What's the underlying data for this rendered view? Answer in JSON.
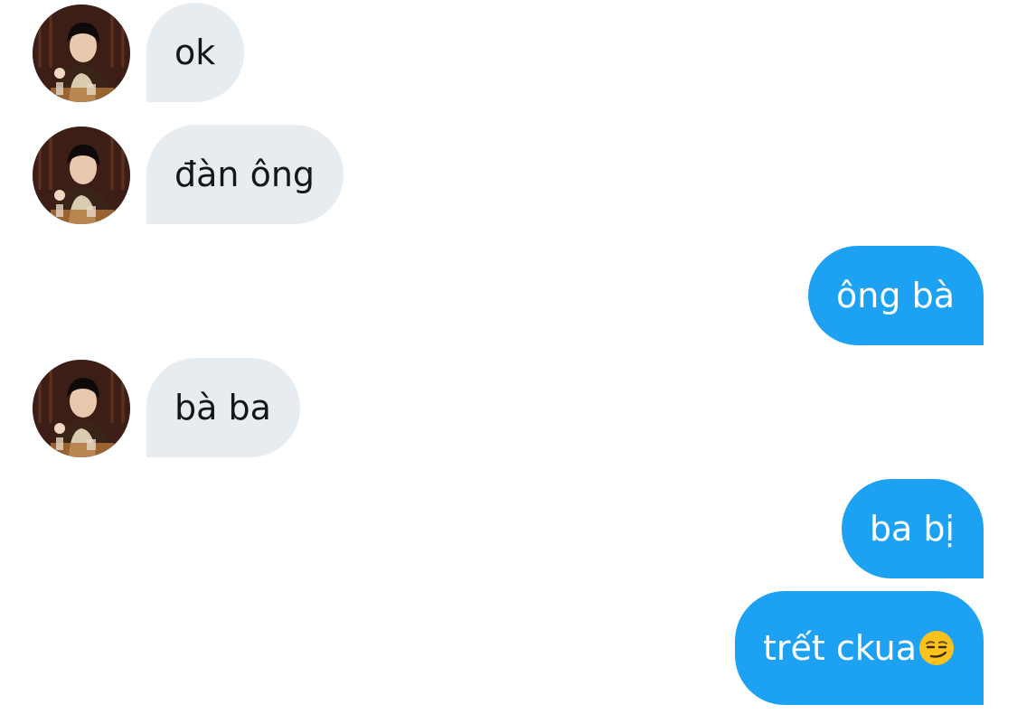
{
  "conversation": {
    "messages": [
      {
        "direction": "incoming",
        "text": "ok",
        "has_avatar": true
      },
      {
        "direction": "incoming",
        "text": "đàn ông",
        "has_avatar": true
      },
      {
        "direction": "outgoing",
        "text": "ông bà"
      },
      {
        "direction": "incoming",
        "text": "bà ba",
        "has_avatar": true
      },
      {
        "direction": "outgoing",
        "text": "ba bị"
      },
      {
        "direction": "outgoing",
        "text": "trết ckua",
        "emoji": "smirking-face-emoji"
      }
    ]
  },
  "colors": {
    "incoming_bubble": "#e6ecf0",
    "incoming_text": "#14171a",
    "outgoing_bubble": "#1da1f2",
    "outgoing_text": "#ffffff"
  },
  "icons": {
    "avatar": "user-avatar-photo",
    "emoji": "smirking-face-emoji"
  }
}
